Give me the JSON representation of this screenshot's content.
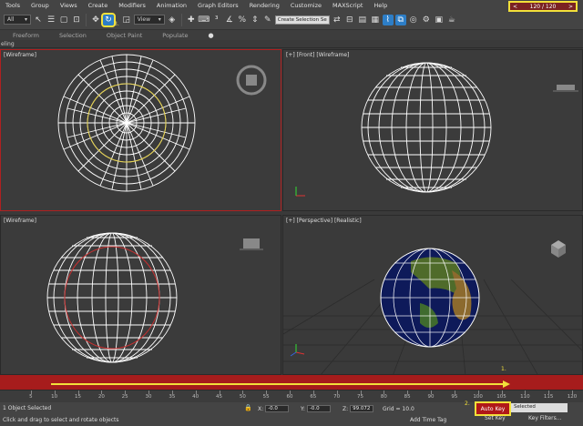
{
  "menu": [
    "Tools",
    "Group",
    "Views",
    "Create",
    "Modifiers",
    "Animation",
    "Graph Editors",
    "Rendering",
    "Customize",
    "MAXScript",
    "Help"
  ],
  "toolbar": {
    "selection_filter": "All",
    "ref_coord": "View",
    "named_selection_placeholder": "Create Selection Se"
  },
  "ribbon": {
    "tabs": [
      "Freeform",
      "Selection",
      "Object Paint",
      "Populate",
      "●"
    ],
    "sub_label": "eling"
  },
  "viewports": {
    "top_left": "[Wireframe]",
    "top_right": "[+] [Front] [Wireframe]",
    "bottom_left": "[Wireframe]",
    "bottom_right": "[+] [Perspective] [Realistic]"
  },
  "timeline": {
    "slider_text": "120 / 120",
    "slider_left": "<",
    "slider_right": ">",
    "progress": 1.0,
    "ticks": [
      5,
      10,
      15,
      20,
      25,
      30,
      35,
      40,
      45,
      50,
      55,
      60,
      65,
      70,
      75,
      80,
      85,
      90,
      95,
      100,
      105,
      110,
      115,
      120
    ]
  },
  "annotations": {
    "step1": "1.",
    "step2": "2.",
    "step3": "3."
  },
  "status": {
    "selected_count": "1 Object Selected",
    "prompt": "Click and drag to select and rotate objects",
    "x_label": "X:",
    "x_value": "-0.0",
    "y_label": "Y:",
    "y_value": "-0.0",
    "z_label": "Z:",
    "z_value": "99.072",
    "grid": "Grid = 10.0",
    "add_time_tag": "Add Time Tag",
    "auto_key": "Auto Key",
    "selected": "Selected",
    "set_key": "Set Key",
    "key_filters": "Key Filters..."
  },
  "colors": {
    "accent_blue": "#2d7ec7",
    "timebar_red": "#a61c1c",
    "highlight_yellow": "#f2e03a"
  }
}
